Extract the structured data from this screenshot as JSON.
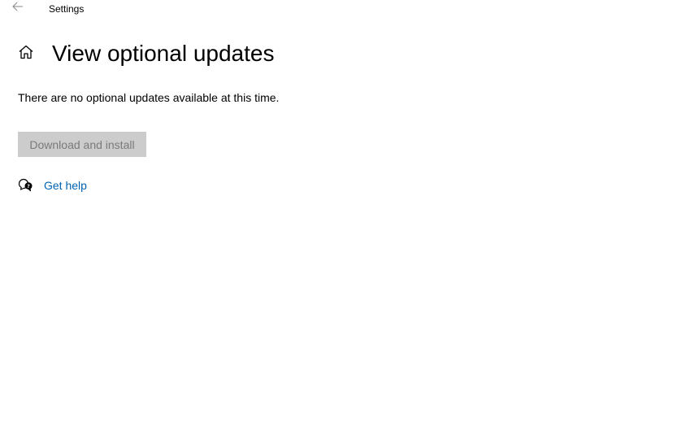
{
  "window": {
    "title": "Settings"
  },
  "icons": {
    "back": "back-arrow-icon",
    "home": "home-icon",
    "help": "chat-help-icon"
  },
  "page": {
    "title": "View optional updates",
    "message": "There are no optional updates available at this time."
  },
  "actions": {
    "download_label": "Download and install",
    "download_enabled": false,
    "get_help_label": "Get help"
  },
  "colors": {
    "link": "#0063b1",
    "button_disabled_bg": "#cccccc",
    "button_disabled_text": "#7a7a7a",
    "back_icon": "#8a8a8a"
  }
}
